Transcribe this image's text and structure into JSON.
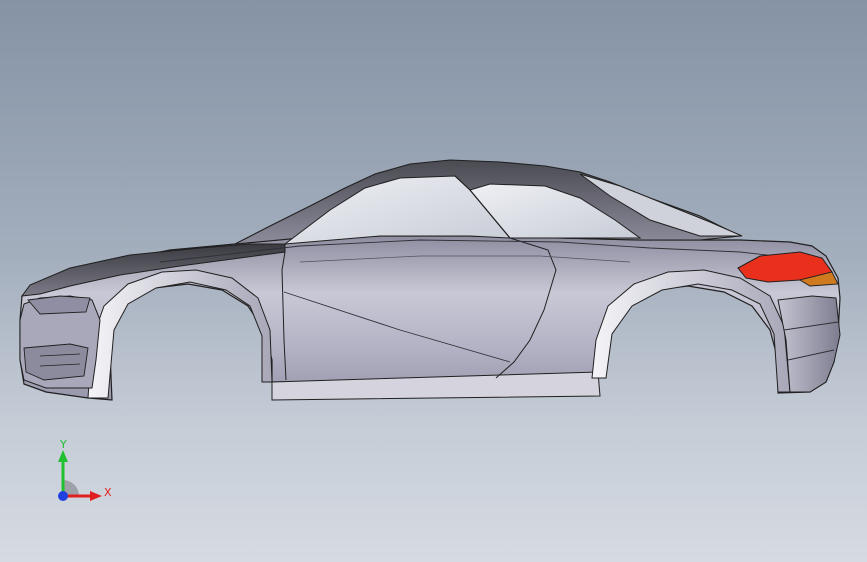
{
  "viewport": {
    "background_top": "#8593a5",
    "background_bottom": "#d6dbe2"
  },
  "model": {
    "body_color": "#b9b8c8",
    "edge_color": "#202020",
    "taillight_color": "#e8301c",
    "reflector_color": "#d07a20"
  },
  "triad": {
    "x_label": "X",
    "y_label": "Y",
    "x_color": "#e02020",
    "y_color": "#20c030",
    "z_color": "#2040e0"
  }
}
